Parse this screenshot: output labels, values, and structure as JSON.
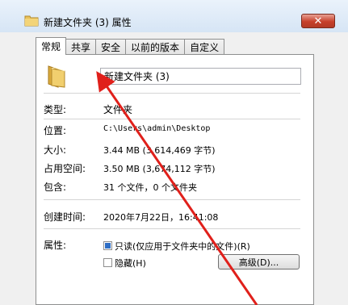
{
  "window": {
    "title": "新建文件夹 (3) 属性",
    "close_label": "✕"
  },
  "tabs": [
    {
      "label": "常规"
    },
    {
      "label": "共享"
    },
    {
      "label": "安全"
    },
    {
      "label": "以前的版本"
    },
    {
      "label": "自定义"
    }
  ],
  "general": {
    "name_value": "新建文件夹 (3)",
    "rows": {
      "type": {
        "label": "类型:",
        "value": "文件夹"
      },
      "location": {
        "label": "位置:",
        "value": "C:\\Users\\admin\\Desktop"
      },
      "size": {
        "label": "大小:",
        "value": "3.44 MB (3,614,469 字节)"
      },
      "size_on_disk": {
        "label": "占用空间:",
        "value": "3.50 MB (3,674,112 字节)"
      },
      "contains": {
        "label": "包含:",
        "value": "31 个文件，0 个文件夹"
      },
      "created": {
        "label": "创建时间:",
        "value": "2020年7月22日，16:41:08"
      }
    },
    "attributes": {
      "label": "属性:",
      "readonly_label": "只读(仅应用于文件夹中的文件)(R)",
      "hidden_label": "隐藏(H)",
      "advanced_label": "高级(D)..."
    }
  },
  "colors": {
    "annotation_arrow": "#e0201b",
    "folder": "#e8c05a"
  }
}
